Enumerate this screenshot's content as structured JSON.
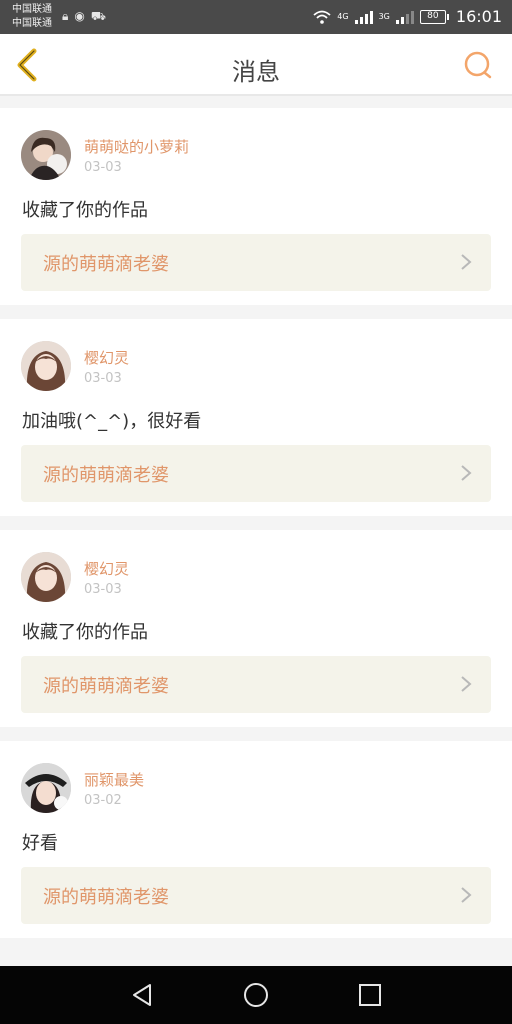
{
  "status": {
    "carrier1": "中国联通",
    "carrier2": "中国联通",
    "net1": "4G",
    "net2": "3G",
    "battery": "80",
    "time": "16:01"
  },
  "nav": {
    "title": "消息"
  },
  "messages": [
    {
      "user": "萌萌哒的小萝莉",
      "date": "03-03",
      "text": "收藏了你的作品",
      "ref": "源的萌萌滴老婆"
    },
    {
      "user": "樱幻灵",
      "date": "03-03",
      "text": "加油哦(^_^)，很好看",
      "ref": "源的萌萌滴老婆"
    },
    {
      "user": "樱幻灵",
      "date": "03-03",
      "text": "收藏了你的作品",
      "ref": "源的萌萌滴老婆"
    },
    {
      "user": "丽颖最美",
      "date": "03-02",
      "text": "好看",
      "ref": "源的萌萌滴老婆"
    }
  ],
  "colors": {
    "accent": "#e0966a",
    "back_arrow": "#e0b020",
    "ref_bg": "#f4f3ea"
  },
  "icons": {
    "back": "back-arrow-icon",
    "search": "search-icon",
    "chevron": "chevron-right-icon"
  }
}
